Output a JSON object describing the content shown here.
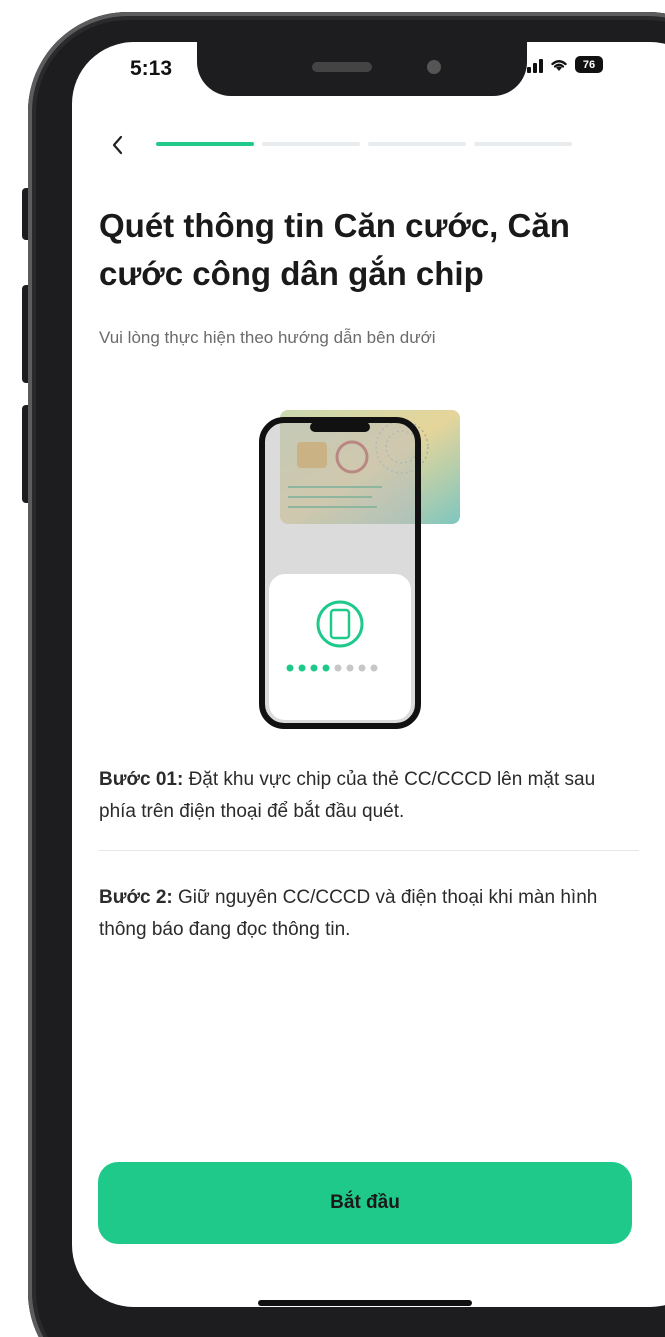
{
  "status_bar": {
    "time": "5:13",
    "battery": "76",
    "icons": [
      "signal-icon",
      "wifi-icon",
      "battery-icon"
    ]
  },
  "nav": {
    "back_icon": "chevron-left-icon",
    "progress_steps": 4,
    "progress_current": 1
  },
  "header": {
    "title": "Quét thông tin Căn cước, Căn cước công dân gắn chip",
    "subtitle": "Vui lòng thực hiện theo hướng dẫn bên dưới"
  },
  "steps": [
    {
      "label": "Bước 01:",
      "text": " Đặt khu vực chip của thẻ CC/CCCD lên mặt sau phía trên điện thoại để bắt đầu quét."
    },
    {
      "label": "Bước 2:",
      "text": " Giữ nguyên CC/CCCD và điện thoại khi màn hình thông báo đang đọc thông tin."
    }
  ],
  "actions": {
    "start_label": "Bắt đầu"
  },
  "colors": {
    "accent": "#1fc98a",
    "progress_inactive": "#e9ecef",
    "text_primary": "#1a1a1a",
    "text_secondary": "#6b6b6b"
  }
}
